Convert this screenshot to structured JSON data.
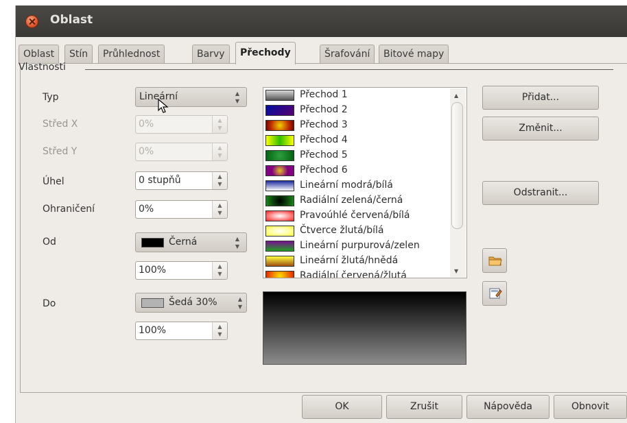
{
  "window": {
    "title": "Oblast"
  },
  "tabs": [
    {
      "label": "Oblast",
      "active": false
    },
    {
      "label": "Stín",
      "active": false
    },
    {
      "label": "Průhlednost",
      "active": false
    },
    {
      "label": "Barvy",
      "active": false
    },
    {
      "label": "Přechody",
      "active": true
    },
    {
      "label": "Šrafování",
      "active": false
    },
    {
      "label": "Bitové mapy",
      "active": false
    }
  ],
  "properties": {
    "group_label": "Vlastnosti",
    "typ": {
      "label": "Typ",
      "value": "Lineární"
    },
    "stred_x": {
      "label": "Střed X",
      "value": "0%"
    },
    "stred_y": {
      "label": "Střed Y",
      "value": "0%"
    },
    "uhel": {
      "label": "Úhel",
      "value": "0 stupňů"
    },
    "ohraniceni": {
      "label": "Ohraničení",
      "value": "0%"
    },
    "od": {
      "label": "Od",
      "color_name": "Černá",
      "color": "#000000",
      "intensity": "100%"
    },
    "do": {
      "label": "Do",
      "color_name": "Šedá 30%",
      "color": "#b3b3b3",
      "intensity": "100%"
    }
  },
  "gradients": [
    {
      "label": "Přechod 1",
      "icon": "gradient-gray"
    },
    {
      "label": "Přechod 2",
      "icon": "gradient-blue-purple"
    },
    {
      "label": "Přechod 3",
      "icon": "gradient-red-yellow-radial"
    },
    {
      "label": "Přechod 4",
      "icon": "gradient-yellow-green"
    },
    {
      "label": "Přechod 5",
      "icon": "gradient-green"
    },
    {
      "label": "Přechod 6",
      "icon": "gradient-purple-yellow"
    },
    {
      "label": "Lineární modrá/bílá",
      "icon": "gradient-blue-white"
    },
    {
      "label": "Radiální zelená/černá",
      "icon": "gradient-green-black"
    },
    {
      "label": "Pravoúhlé červená/bílá",
      "icon": "gradient-red-white"
    },
    {
      "label": "Čtverce žlutá/bílá",
      "icon": "gradient-yellow-white"
    },
    {
      "label": "Lineární purpurová/zelen",
      "icon": "gradient-purple-green"
    },
    {
      "label": "Lineární žlutá/hnědá",
      "icon": "gradient-yellow-brown"
    },
    {
      "label": "Radiální červená/žlutá",
      "icon": "gradient-red-yellow"
    }
  ],
  "actions": {
    "pridat": "Přidat...",
    "zmenit": "Změnit...",
    "odstranit": "Odstranit..."
  },
  "footer": {
    "ok": "OK",
    "zrusit": "Zrušit",
    "napoveda": "Nápověda",
    "obnovit": "Obnovit"
  }
}
